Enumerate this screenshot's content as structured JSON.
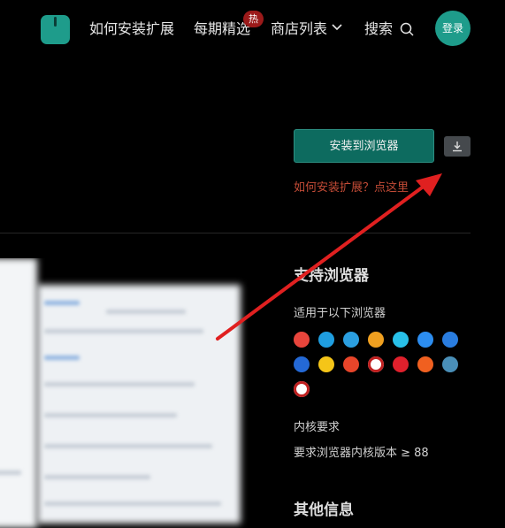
{
  "header": {
    "nav": [
      "如何安装扩展",
      "每期精选",
      "商店列表",
      "搜索"
    ],
    "hot_badge": "热",
    "login": "登录"
  },
  "install": {
    "button": "安装到浏览器",
    "help_link": "如何安装扩展？点这里"
  },
  "sidebar": {
    "supported_title": "支持浏览器",
    "supported_sub": "适用于以下浏览器",
    "browsers": [
      {
        "icon": "chrome-icon",
        "color": "#e8453c"
      },
      {
        "icon": "edge-icon",
        "color": "#1f9ee0"
      },
      {
        "icon": "browser-360-icon",
        "color": "#2b9fe0"
      },
      {
        "icon": "browser-colorful-icon",
        "color": "#f0a020"
      },
      {
        "icon": "ie-icon",
        "color": "#28c0e8"
      },
      {
        "icon": "qq-browser-icon",
        "color": "#2c8df0"
      },
      {
        "icon": "sogou-browser-icon",
        "color": "#2a7de0"
      },
      {
        "icon": "maxthon-icon",
        "color": "#2469d6"
      },
      {
        "icon": "star-browser-icon",
        "color": "#f5c518"
      },
      {
        "icon": "cent-browser-icon",
        "color": "#e8452a"
      },
      {
        "icon": "yandex-icon",
        "color": "#ffffff"
      },
      {
        "icon": "opera-icon",
        "color": "#e0202c"
      },
      {
        "icon": "uc-browser-icon",
        "color": "#f06020"
      },
      {
        "icon": "sphere-browser-icon",
        "color": "#4a8fb8"
      },
      {
        "icon": "panda-browser-icon",
        "color": "#ffffff"
      }
    ],
    "kernel_title": "内核要求",
    "kernel_text": "要求浏览器内核版本 ≥ 88",
    "other_title": "其他信息"
  },
  "colors": {
    "accent": "#1e9c8b",
    "link": "#c24b36",
    "arrow": "#e02020"
  }
}
